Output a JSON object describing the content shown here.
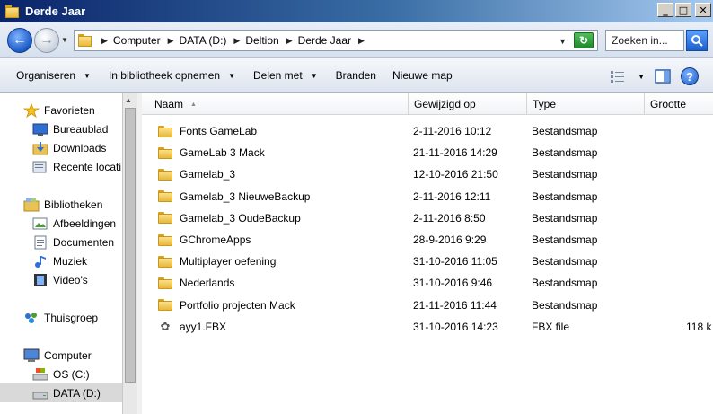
{
  "window": {
    "title": "Derde Jaar"
  },
  "address": {
    "crumbs": [
      "Computer",
      "DATA (D:)",
      "Deltion",
      "Derde Jaar"
    ],
    "search_placeholder": "Zoeken in..."
  },
  "toolbar": {
    "items": [
      "Organiseren",
      "In bibliotheek opnemen",
      "Delen met",
      "Branden",
      "Nieuwe map"
    ]
  },
  "nav": {
    "items": [
      {
        "label": "Favorieten",
        "icon": "star-icon"
      },
      {
        "label": "Bureaublad",
        "icon": "desktop-icon"
      },
      {
        "label": "Downloads",
        "icon": "downloads-icon"
      },
      {
        "label": "Recente locati",
        "icon": "recent-places-icon"
      },
      {
        "label": "Bibliotheken",
        "icon": "libraries-icon"
      },
      {
        "label": "Afbeeldingen",
        "icon": "pictures-icon"
      },
      {
        "label": "Documenten",
        "icon": "documents-icon"
      },
      {
        "label": "Muziek",
        "icon": "music-icon"
      },
      {
        "label": "Video's",
        "icon": "videos-icon"
      },
      {
        "label": "Thuisgroep",
        "icon": "homegroup-icon"
      },
      {
        "label": "Computer",
        "icon": "computer-icon"
      },
      {
        "label": "OS (C:)",
        "icon": "drive-c-icon"
      },
      {
        "label": "DATA (D:)",
        "icon": "drive-d-icon"
      }
    ],
    "selected": "DATA (D:)"
  },
  "columns": {
    "name": "Naam",
    "modified": "Gewijzigd op",
    "type": "Type",
    "size": "Grootte"
  },
  "files": [
    {
      "name": "Fonts GameLab",
      "modified": "2-11-2016 10:12",
      "type": "Bestandsmap",
      "size": "",
      "icon": "folder-icon"
    },
    {
      "name": "GameLab 3 Mack",
      "modified": "21-11-2016 14:29",
      "type": "Bestandsmap",
      "size": "",
      "icon": "folder-icon"
    },
    {
      "name": "Gamelab_3",
      "modified": "12-10-2016 21:50",
      "type": "Bestandsmap",
      "size": "",
      "icon": "folder-icon"
    },
    {
      "name": "Gamelab_3 NieuweBackup",
      "modified": "2-11-2016 12:11",
      "type": "Bestandsmap",
      "size": "",
      "icon": "folder-icon"
    },
    {
      "name": "Gamelab_3 OudeBackup",
      "modified": "2-11-2016 8:50",
      "type": "Bestandsmap",
      "size": "",
      "icon": "folder-icon"
    },
    {
      "name": "GChromeApps",
      "modified": "28-9-2016 9:29",
      "type": "Bestandsmap",
      "size": "",
      "icon": "folder-icon"
    },
    {
      "name": "Multiplayer oefening",
      "modified": "31-10-2016 11:05",
      "type": "Bestandsmap",
      "size": "",
      "icon": "folder-icon"
    },
    {
      "name": "Nederlands",
      "modified": "31-10-2016 9:46",
      "type": "Bestandsmap",
      "size": "",
      "icon": "folder-icon"
    },
    {
      "name": "Portfolio projecten Mack",
      "modified": "21-11-2016 11:44",
      "type": "Bestandsmap",
      "size": "",
      "icon": "folder-icon"
    },
    {
      "name": "ayy1.FBX",
      "modified": "31-10-2016 14:23",
      "type": "FBX file",
      "size": "118 k",
      "icon": "fbx-file-icon"
    }
  ]
}
